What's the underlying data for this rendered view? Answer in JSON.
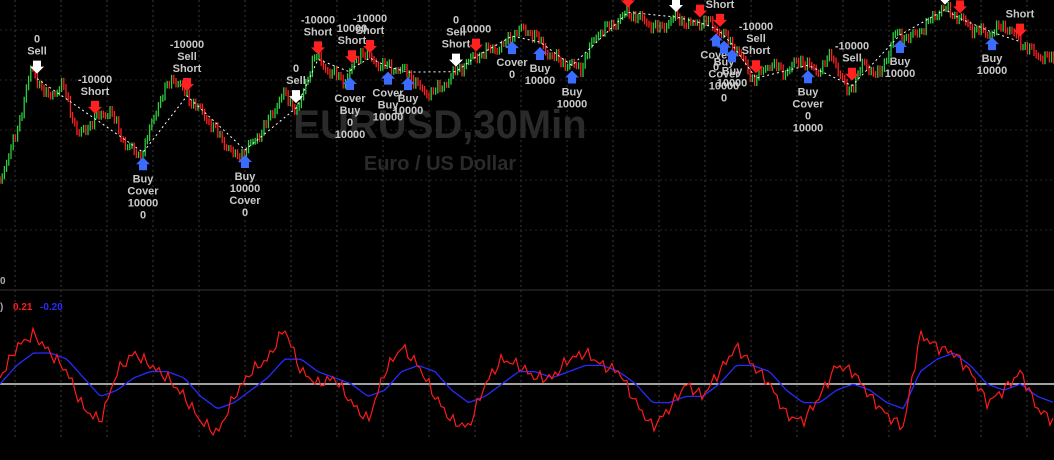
{
  "chart_data": [
    {
      "type": "line",
      "title": "EURUSD,30Min",
      "subtitle": "Euro / US Dollar",
      "ylim": [
        0,
        100
      ],
      "grid": true,
      "colors": {
        "up": "#2ecc40",
        "down": "#ff2020",
        "trail": "#ffffff",
        "buy_arrow": "#3a6cff",
        "sell_arrow": "#ff2020",
        "exit_arrow": "#ffffff"
      },
      "series": [
        {
          "values": [
            20,
            40,
            72,
            58,
            64,
            40,
            48,
            52,
            36,
            30,
            54,
            68,
            58,
            50,
            40,
            30,
            36,
            46,
            60,
            52,
            78,
            70,
            66,
            80,
            74,
            72,
            70,
            60,
            62,
            70,
            76,
            80,
            82,
            90,
            88,
            78,
            74,
            72,
            88,
            92,
            98,
            94,
            90,
            96,
            92,
            94,
            88,
            80,
            66,
            74,
            70,
            76,
            70,
            78,
            60,
            74,
            68,
            88,
            86,
            92,
            100,
            96,
            90,
            88,
            92,
            84,
            78,
            76
          ]
        }
      ],
      "signals": [
        {
          "text": [
            "0",
            "Sell"
          ],
          "dir": "exit"
        },
        {
          "text": [
            "-10000",
            "Short"
          ],
          "dir": "sell"
        },
        {
          "text": [
            "Buy",
            "Cover",
            "10000",
            "0"
          ],
          "dir": "buy"
        },
        {
          "text": [
            "-10000",
            "Sell",
            "Short"
          ],
          "dir": "sell"
        },
        {
          "text": [
            "Buy",
            "10000",
            "Cover",
            "0"
          ],
          "dir": "buy"
        },
        {
          "text": [
            "0",
            "Sell"
          ],
          "dir": "exit"
        },
        {
          "text": [
            "-10000",
            "Short"
          ],
          "dir": "sell"
        },
        {
          "text": [
            "10000",
            "Short"
          ],
          "dir": "sell"
        },
        {
          "text": [
            "-10000",
            "Short"
          ],
          "dir": "sell"
        },
        {
          "text": [
            "Cover",
            "Buy",
            "0",
            "10000"
          ],
          "dir": "buy"
        },
        {
          "text": [
            "Cover",
            "Buy",
            "10000"
          ],
          "dir": "buy"
        },
        {
          "text": [
            "Buy",
            "10000"
          ],
          "dir": "buy"
        },
        {
          "text": [
            "0",
            "Sell",
            "Short"
          ],
          "dir": "exit"
        },
        {
          "text": [
            "10000"
          ],
          "dir": "sell"
        },
        {
          "text": [
            "Cover",
            "0"
          ],
          "dir": "buy"
        },
        {
          "text": [
            "Buy",
            "10000"
          ],
          "dir": "buy"
        },
        {
          "text": [
            "Buy",
            "10000"
          ],
          "dir": "buy"
        },
        {
          "text": [
            "-10000",
            "Short"
          ],
          "dir": "sell"
        },
        {
          "text": [
            "0",
            "Sell"
          ],
          "dir": "exit"
        },
        {
          "text": [
            "Short"
          ],
          "dir": "sell"
        },
        {
          "text": [
            "Cover",
            "0"
          ],
          "dir": "buy"
        },
        {
          "text": [
            "Buy",
            "Cover",
            "10000",
            "0"
          ],
          "dir": "buy"
        },
        {
          "text": [
            "Buy",
            "10000"
          ],
          "dir": "buy"
        },
        {
          "text": [
            "-10000",
            "Short"
          ],
          "dir": "sell"
        },
        {
          "text": [
            "-10000",
            "Sell",
            "Short"
          ],
          "dir": "sell"
        },
        {
          "text": [
            "Buy",
            "Cover",
            "0",
            "10000"
          ],
          "dir": "buy"
        },
        {
          "text": [
            "-10000",
            "Sell"
          ],
          "dir": "sell"
        },
        {
          "text": [
            "Buy",
            "10000"
          ],
          "dir": "buy"
        },
        {
          "text": [
            "0",
            "Sell"
          ],
          "dir": "exit"
        },
        {
          "text": [
            "Short"
          ],
          "dir": "sell"
        },
        {
          "text": [
            "Buy",
            "10000"
          ],
          "dir": "buy"
        },
        {
          "text": [
            "Short"
          ],
          "dir": "sell"
        }
      ]
    },
    {
      "type": "line",
      "axis_label": "0",
      "readout": {
        "prefix": ")",
        "value1": "0.21",
        "value2": "-0.20"
      },
      "colors": {
        "fast": "#ff1a1a",
        "slow": "#2a2aff",
        "zero": "#ffffff"
      },
      "ylim": [
        -1,
        1
      ],
      "series": [
        {
          "values": [
            0.1,
            0.6,
            0.8,
            0.5,
            0.2,
            -0.4,
            -0.6,
            0.2,
            0.5,
            0.3,
            0.1,
            -0.2,
            -0.6,
            -0.8,
            -0.2,
            0.2,
            0.4,
            0.9,
            0.2,
            0.0,
            0.1,
            -0.3,
            -0.6,
            0.2,
            0.6,
            0.3,
            -0.2,
            -0.6,
            -0.7,
            0.0,
            0.4,
            0.3,
            0.1,
            0.1,
            0.4,
            0.5,
            0.3,
            0.2,
            -0.3,
            -0.7,
            -0.4,
            0.0,
            -0.2,
            0.2,
            0.6,
            0.3,
            0.0,
            -0.5,
            -0.6,
            -0.2,
            0.3,
            0.2,
            -0.2,
            -0.5,
            -0.7,
            0.8,
            0.6,
            0.5,
            0.2,
            -0.3,
            -0.1,
            0.2,
            -0.4,
            -0.6
          ]
        },
        {
          "values": [
            0.0,
            0.3,
            0.5,
            0.5,
            0.4,
            0.1,
            -0.2,
            -0.1,
            0.1,
            0.2,
            0.2,
            0.1,
            -0.2,
            -0.4,
            -0.3,
            -0.1,
            0.1,
            0.4,
            0.4,
            0.2,
            0.1,
            0.0,
            -0.2,
            -0.1,
            0.2,
            0.3,
            0.2,
            -0.1,
            -0.3,
            -0.2,
            0.0,
            0.2,
            0.2,
            0.1,
            0.2,
            0.3,
            0.3,
            0.2,
            0.0,
            -0.3,
            -0.3,
            -0.2,
            -0.2,
            0.0,
            0.3,
            0.3,
            0.2,
            -0.1,
            -0.3,
            -0.3,
            -0.1,
            0.0,
            -0.1,
            -0.3,
            -0.4,
            0.2,
            0.4,
            0.5,
            0.3,
            0.0,
            -0.1,
            0.0,
            -0.2,
            -0.3
          ]
        }
      ]
    }
  ]
}
